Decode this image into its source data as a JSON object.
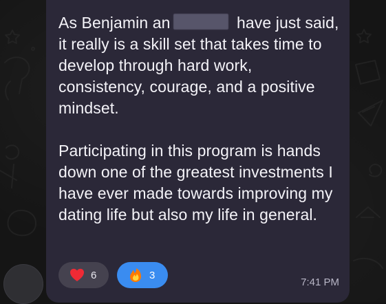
{
  "message": {
    "paragraph1_start": "As Benjamin an",
    "paragraph1_end": " have just said, it really is a skill set that takes time to develop through hard work, consistency, courage, and a positive mindset.",
    "paragraph2": "Participating in this program is hands down one of the greatest investments I have ever made towards improving my dating life but also my life in general.",
    "time": "7:41 PM"
  },
  "reactions": [
    {
      "emoji": "heart",
      "count": "6"
    },
    {
      "emoji": "fire",
      "count": "3"
    }
  ],
  "colors": {
    "bubble": "#2b2838",
    "selected_reaction": "#3a8cf0",
    "heart": "#ef2a35",
    "fire": "#ff7a00"
  }
}
